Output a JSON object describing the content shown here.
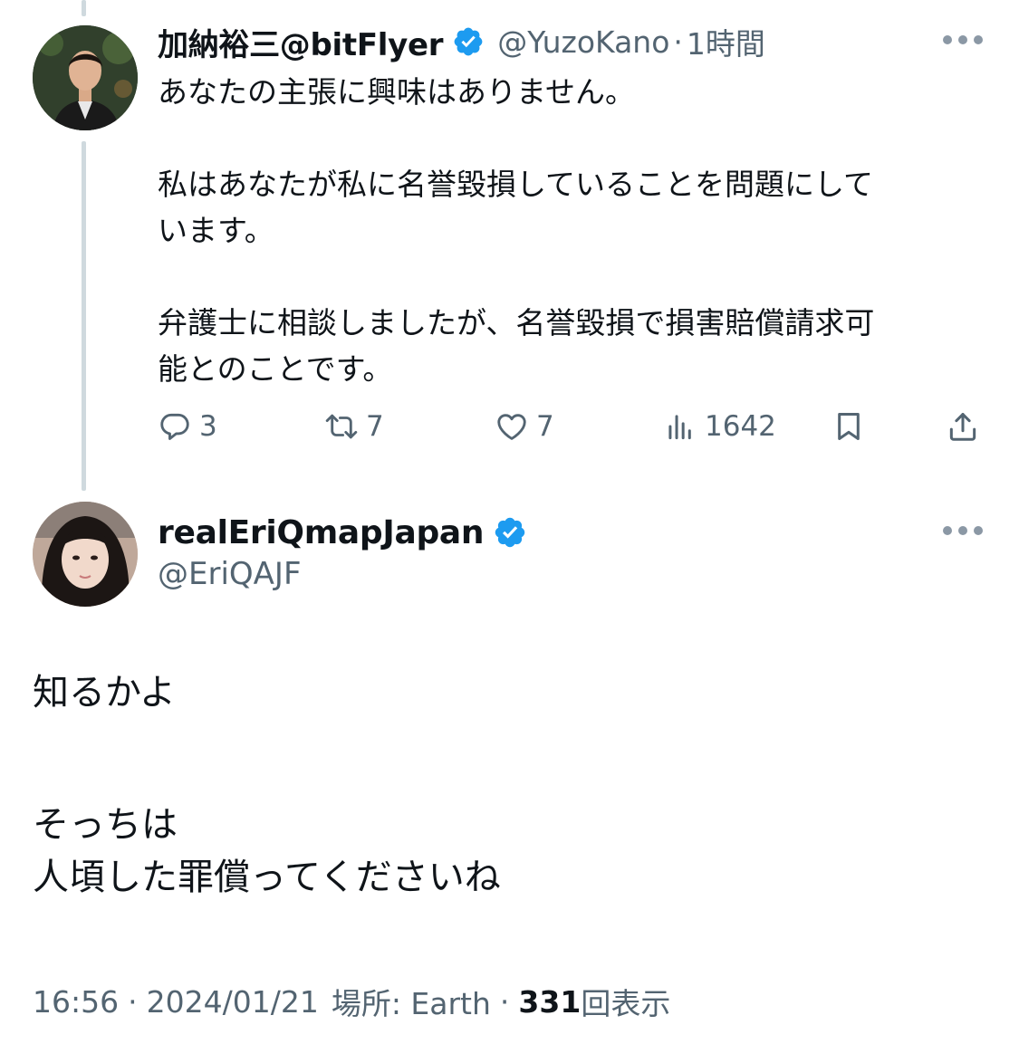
{
  "parent_tweet": {
    "display_name": "加納裕三@bitFlyer",
    "handle": "@YuzoKano",
    "separator": "·",
    "time": "1時間",
    "text_lines": [
      "あなたの主張に興味はありません。",
      "",
      "私はあなたが私に名誉毀損していることを問題にして",
      "います。",
      "",
      "弁護士に相談しましたが、名誉毀損で損害賠償請求可",
      "能とのことです。"
    ],
    "actions": {
      "replies": "3",
      "reposts": "7",
      "likes": "7",
      "views": "1642"
    }
  },
  "main_tweet": {
    "display_name": "realEriQmapJapan",
    "handle": "@EriQAJF",
    "text_lines": [
      "知るかよ",
      "",
      "そっちは",
      "人頃した罪償ってくださいね"
    ],
    "meta": {
      "time": "16:56",
      "sep1": "·",
      "date": "2024/01/21",
      "location_label": "場所: Earth",
      "sep2": "·",
      "views_count": "331",
      "views_label": "回表示"
    }
  },
  "colors": {
    "verified_badge": "#1d9bf0",
    "secondary_text": "#536471",
    "primary_text": "#0f1419",
    "thread_line": "#cfd9de"
  },
  "icons": [
    "reply-icon",
    "repost-icon",
    "like-icon",
    "views-icon",
    "bookmark-icon",
    "share-icon",
    "verified-badge-icon",
    "more-options-icon"
  ]
}
